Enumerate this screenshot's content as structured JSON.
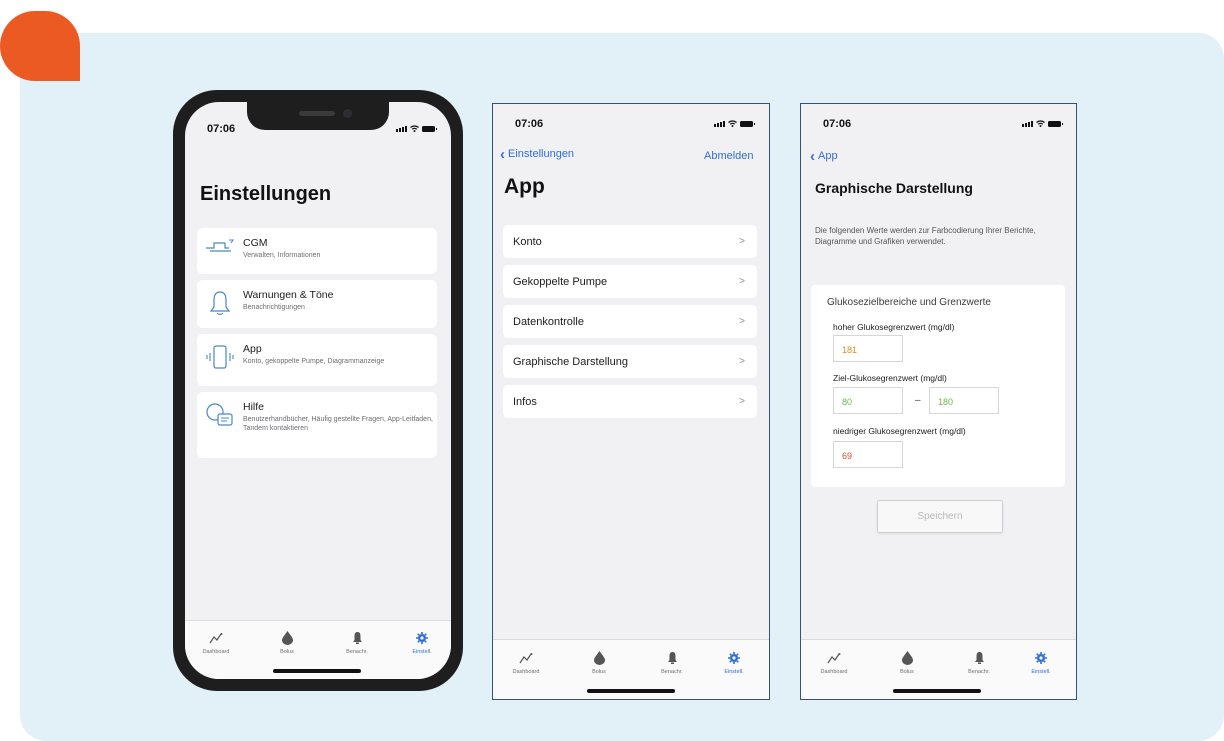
{
  "colors": {
    "accent": "#2f6fd6",
    "panel_bg": "#e2f0f7",
    "brand_orange": "#ec5a24",
    "high": "#e08a1e",
    "target": "#6cb94a",
    "low": "#d9482b"
  },
  "status_bar": {
    "time": "07:06"
  },
  "phone1": {
    "title": "Einstellungen",
    "items": [
      {
        "icon": "cgm-sensor-icon",
        "title": "CGM",
        "subtitle": "Verwalten, Informationen"
      },
      {
        "icon": "bell-icon",
        "title": "Warnungen & Töne",
        "subtitle": "Benachrichtigungen"
      },
      {
        "icon": "phone-vibrate-icon",
        "title": "App",
        "subtitle": "Konto, gekoppelte Pumpe, Diagrammanzeige"
      },
      {
        "icon": "chat-bubbles-icon",
        "title": "Hilfe",
        "subtitle": "Benutzerhandbücher, Häufig gestellte Fragen, App-Leitfaden, Tandem kontaktieren"
      }
    ]
  },
  "tabs": [
    {
      "icon": "dashboard-chart-icon",
      "label": "Dashboard"
    },
    {
      "icon": "drop-icon",
      "label": "Bolus"
    },
    {
      "icon": "bell-icon",
      "label": "Benachr."
    },
    {
      "icon": "gear-icon",
      "label": "Einstell."
    }
  ],
  "phone2": {
    "back_label": "Einstellungen",
    "right_action": "Abmelden",
    "title": "App",
    "rows": [
      "Konto",
      "Gekoppelte Pumpe",
      "Datenkontrolle",
      "Graphische Darstellung",
      "Infos"
    ]
  },
  "phone3": {
    "back_label": "App",
    "title": "Graphische Darstellung",
    "description": "Die folgenden Werte werden zur Farbcodierung Ihrer Berichte, Diagramme und Grafiken verwendet.",
    "card_title": "Glukosezielbereiche und Grenzwerte",
    "high_label": "hoher Glukosegrenzwert (mg/dl)",
    "high_value": "181",
    "target_label": "Ziel-Glukosegrenzwert (mg/dl)",
    "target_low": "80",
    "target_sep": "–",
    "target_high": "180",
    "low_label": "niedriger Glukosegrenzwert (mg/dl)",
    "low_value": "69",
    "save_label": "Speichern"
  }
}
